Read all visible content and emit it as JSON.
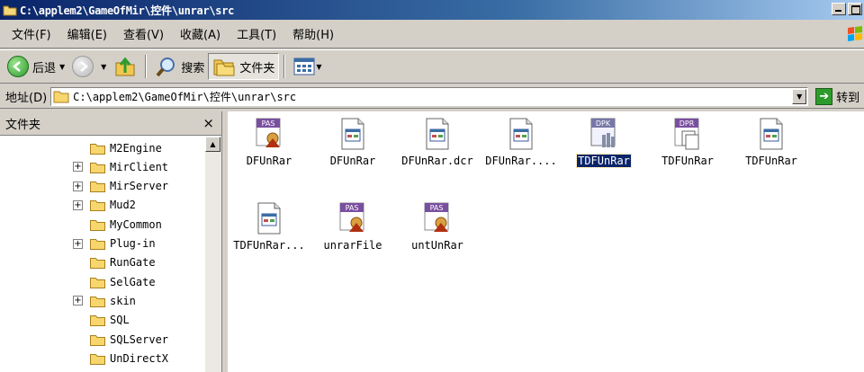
{
  "window": {
    "title": "C:\\applem2\\GameOfMir\\控件\\unrar\\src"
  },
  "menu": [
    "文件(F)",
    "编辑(E)",
    "查看(V)",
    "收藏(A)",
    "工具(T)",
    "帮助(H)"
  ],
  "toolbar": {
    "back_label": "后退",
    "search_label": "搜索",
    "folders_label": "文件夹"
  },
  "address": {
    "label": "地址(D)",
    "path": "C:\\applem2\\GameOfMir\\控件\\unrar\\src",
    "go_label": "转到"
  },
  "folder_pane": {
    "title": "文件夹",
    "close_glyph": "×",
    "items": [
      {
        "name": "M2Engine",
        "expander": ""
      },
      {
        "name": "MirClient",
        "expander": "+"
      },
      {
        "name": "MirServer",
        "expander": "+"
      },
      {
        "name": "Mud2",
        "expander": "+"
      },
      {
        "name": "MyCommon",
        "expander": ""
      },
      {
        "name": "Plug-in",
        "expander": "+"
      },
      {
        "name": "RunGate",
        "expander": ""
      },
      {
        "name": "SelGate",
        "expander": ""
      },
      {
        "name": "skin",
        "expander": "+"
      },
      {
        "name": "SQL",
        "expander": ""
      },
      {
        "name": "SQLServer",
        "expander": ""
      },
      {
        "name": "UnDirectX",
        "expander": ""
      }
    ]
  },
  "files": [
    {
      "name": "DFUnRar",
      "icon": "pas-icon",
      "selected": false
    },
    {
      "name": "DFUnRar",
      "icon": "form-file-icon",
      "selected": false
    },
    {
      "name": "DFUnRar.dcr",
      "icon": "form-file-icon",
      "selected": false
    },
    {
      "name": "DFUnRar....",
      "icon": "form-file-icon",
      "selected": false
    },
    {
      "name": "TDFUnRar",
      "icon": "dpk-icon",
      "selected": true
    },
    {
      "name": "TDFUnRar",
      "icon": "dpr-icon",
      "selected": false
    },
    {
      "name": "TDFUnRar",
      "icon": "form-file-icon",
      "selected": false
    },
    {
      "name": "TDFUnRar...",
      "icon": "form-file-icon",
      "selected": false
    },
    {
      "name": "unrarFile",
      "icon": "pas-icon",
      "selected": false
    },
    {
      "name": "untUnRar",
      "icon": "pas-icon",
      "selected": false
    }
  ],
  "colors": {
    "title_bar": "#0a246a",
    "selection": "#0a246a",
    "chrome": "#d4d0c8"
  }
}
